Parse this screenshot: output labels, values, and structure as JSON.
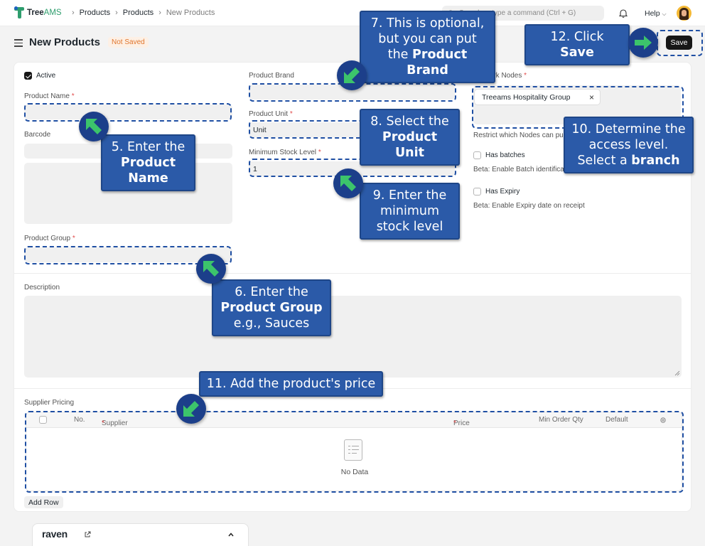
{
  "app": {
    "logo_part1": "Tree",
    "logo_part2": "AMS",
    "breadcrumbs": [
      "Products",
      "Products",
      "New Products"
    ],
    "search_placeholder": "Search or type a command (Ctrl + G)",
    "help_label": "Help"
  },
  "page": {
    "title": "New Products",
    "status_badge": "Not Saved",
    "save_label": "Save"
  },
  "form": {
    "active_label": "Active",
    "active_checked": true,
    "product_name_label": "Product Name",
    "barcode_label": "Barcode",
    "product_group_label": "Product Group",
    "product_brand_label": "Product Brand",
    "product_unit_label": "Product Unit",
    "product_unit_value": "Unit",
    "min_stock_label": "Minimum Stock Level",
    "min_stock_value": "1",
    "network_nodes_label": "Network Nodes",
    "network_node_tag": "Treeams Hospitality Group",
    "network_nodes_hint": "Restrict which Nodes can purchase",
    "has_batches_label": "Has batches",
    "has_batches_hint": "Beta: Enable Batch identification",
    "has_expiry_label": "Has Expiry",
    "has_expiry_hint": "Beta: Enable Expiry date on receipt",
    "description_label": "Description",
    "required_mark": "*"
  },
  "supplier_pricing": {
    "label": "Supplier Pricing",
    "columns": [
      "No.",
      "Supplier",
      "Price",
      "Min Order Qty",
      "Default"
    ],
    "empty_text": "No Data",
    "add_row_label": "Add Row"
  },
  "raven": {
    "label": "raven"
  },
  "annotations": {
    "step5": [
      "5. Enter the",
      "Product",
      "Name"
    ],
    "step6": [
      "6. Enter the",
      "Product Group",
      "e.g., Sauces"
    ],
    "step7": [
      "7. This is optional,",
      "but you can put",
      "the ",
      "Product Brand"
    ],
    "step8": [
      "8. Select the",
      "Product Unit"
    ],
    "step9": [
      "9. Enter the",
      "minimum",
      "stock level"
    ],
    "step10": [
      "10. Determine the",
      "access level.",
      "Select a ",
      "branch"
    ],
    "step11": "11. Add the product's price",
    "step12": [
      "12. Click ",
      "Save"
    ]
  },
  "colors": {
    "callout_bg": "#2b5aa8",
    "dash_border": "#1f4fa3",
    "arrow_green": "#3cc46b",
    "brand_green": "#2f9e6e",
    "badge_orange": "#e0762e"
  }
}
